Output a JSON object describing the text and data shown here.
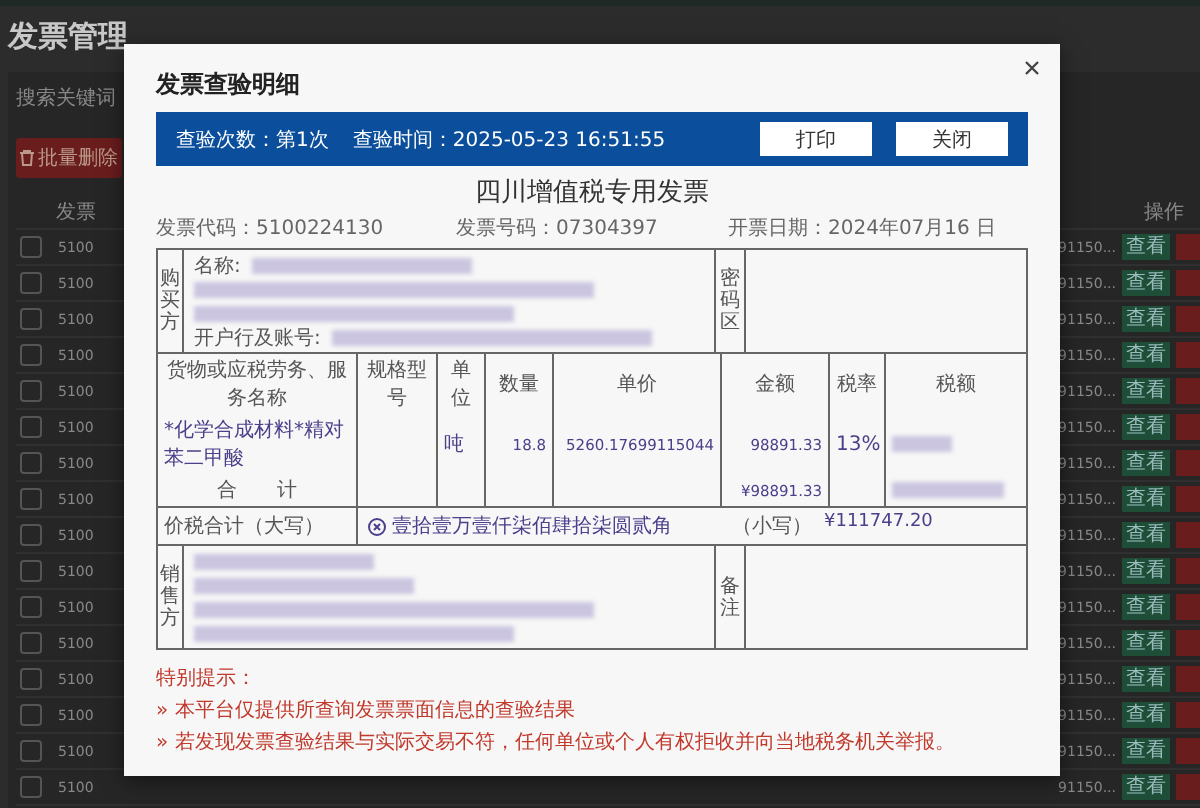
{
  "page": {
    "title": "发票管理",
    "search_label": "搜索关键词",
    "batch_delete": "批量删除",
    "columns": [
      "发票",
      "操作"
    ],
    "rows": [
      {
        "checked": false,
        "code": "5100",
        "number": "91150...",
        "view": "查看"
      },
      {
        "checked": false,
        "code": "5100",
        "number": "91150...",
        "view": "查看"
      },
      {
        "checked": false,
        "code": "5100",
        "number": "91150...",
        "view": "查看"
      },
      {
        "checked": false,
        "code": "5100",
        "number": "91150...",
        "view": "查看"
      },
      {
        "checked": false,
        "code": "5100",
        "number": "91150...",
        "view": "查看"
      },
      {
        "checked": false,
        "code": "5100",
        "number": "91150...",
        "view": "查看"
      },
      {
        "checked": false,
        "code": "5100",
        "number": "91150...",
        "view": "查看"
      },
      {
        "checked": false,
        "code": "5100",
        "number": "91150...",
        "view": "查看"
      },
      {
        "checked": false,
        "code": "5100",
        "number": "91150...",
        "view": "查看"
      },
      {
        "checked": false,
        "code": "5100",
        "number": "91150...",
        "view": "查看"
      },
      {
        "checked": false,
        "code": "5100",
        "number": "91150...",
        "view": "查看"
      },
      {
        "checked": false,
        "code": "5100",
        "number": "91150...",
        "view": "查看"
      },
      {
        "checked": false,
        "code": "5100",
        "number": "91150...",
        "view": "查看"
      },
      {
        "checked": false,
        "code": "5100",
        "number": "91150...",
        "view": "查看"
      },
      {
        "checked": false,
        "code": "5100",
        "number": "91150...",
        "view": "查看"
      },
      {
        "checked": false,
        "code": "5100",
        "number": "91150...",
        "view": "查看"
      }
    ]
  },
  "dialog": {
    "title": "发票查验明细",
    "check_count": "查验次数：第1次",
    "check_time": "查验时间：2025-05-23 16:51:55",
    "buttons": [
      "打印",
      "关闭"
    ],
    "invoice": {
      "title": "四川增值税专用发票",
      "code": "发票代码：5100224130",
      "number": "发票号码：07304397",
      "date": "开票日期：2024年07月16 日",
      "buyer": {
        "label": "购买方",
        "name_label": "名称:",
        "bank_label": "开户行及账号:"
      },
      "cipher_label": "密码区",
      "item_columns": [
        "货物或应税劳务、服务名称",
        "规格型号",
        "单位",
        "数量",
        "单价",
        "金额",
        "税率",
        "税额"
      ],
      "items": [
        {
          "name": "*化学合成材料*精对苯二甲酸",
          "unit": "吨",
          "quantity": "18.8",
          "price": "5260.17699115044",
          "amount": "98891.33",
          "rate": "13%"
        }
      ],
      "total_label": "合　　计",
      "total_amount": "¥98891.33",
      "grand_label": "价税合计（大写）",
      "grand_words": "壹拾壹万壹仟柒佰肆拾柒圆贰角",
      "grand_small_label": "（小写）",
      "grand_small": "¥111747.20",
      "seller": {
        "label": "销售方"
      },
      "remark_label": "备注"
    },
    "notice": {
      "title": "特别提示：",
      "items": [
        "» 本平台仅提供所查询发票票面信息的查验结果",
        "» 若发现发票查验结果与实际交易不符，任何单位或个人有权拒收并向当地税务机关举报。"
      ]
    }
  }
}
